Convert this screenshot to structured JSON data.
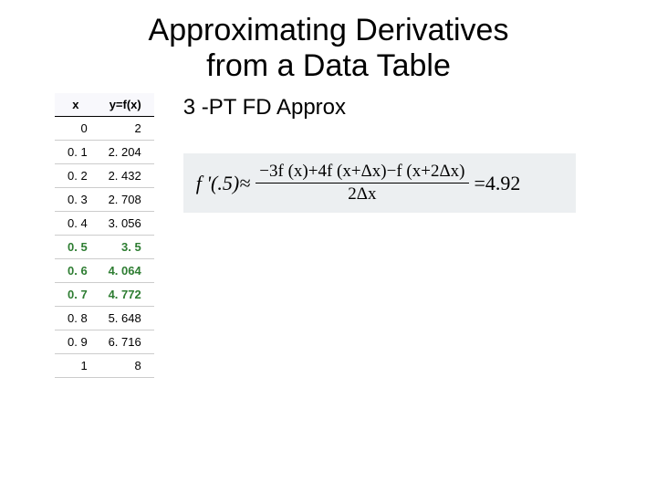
{
  "title_line1": "Approximating Derivatives",
  "title_line2": "from a Data Table",
  "subhead": "3 -PT FD Approx",
  "table": {
    "headers": {
      "x": "x",
      "y": "y=f(x)"
    },
    "rows": [
      {
        "x": "0",
        "y": "2",
        "highlight": false
      },
      {
        "x": "0. 1",
        "y": "2. 204",
        "highlight": false
      },
      {
        "x": "0. 2",
        "y": "2. 432",
        "highlight": false
      },
      {
        "x": "0. 3",
        "y": "2. 708",
        "highlight": false
      },
      {
        "x": "0. 4",
        "y": "3. 056",
        "highlight": false
      },
      {
        "x": "0. 5",
        "y": "3. 5",
        "highlight": true
      },
      {
        "x": "0. 6",
        "y": "4. 064",
        "highlight": true
      },
      {
        "x": "0. 7",
        "y": "4. 772",
        "highlight": true
      },
      {
        "x": "0. 8",
        "y": "5. 648",
        "highlight": false
      },
      {
        "x": "0. 9",
        "y": "6. 716",
        "highlight": false
      },
      {
        "x": "1",
        "y": "8",
        "highlight": false
      }
    ]
  },
  "formula": {
    "lhs": "f '(.5)≈",
    "numerator": "−3f (x)+4f (x+Δx)−f (x+2Δx)",
    "denominator": "2Δx",
    "rhs": "=4.92"
  },
  "chart_data": {
    "type": "table",
    "columns": [
      "x",
      "y=f(x)"
    ],
    "rows": [
      [
        0.0,
        2.0
      ],
      [
        0.1,
        2.204
      ],
      [
        0.2,
        2.432
      ],
      [
        0.3,
        2.708
      ],
      [
        0.4,
        3.056
      ],
      [
        0.5,
        3.5
      ],
      [
        0.6,
        4.064
      ],
      [
        0.7,
        4.772
      ],
      [
        0.8,
        5.648
      ],
      [
        0.9,
        6.716
      ],
      [
        1.0,
        8.0
      ]
    ],
    "highlighted_x": [
      0.5,
      0.6,
      0.7
    ],
    "derivative_point": 0.5,
    "derivative_approx": 4.92,
    "method": "3-point forward difference"
  }
}
